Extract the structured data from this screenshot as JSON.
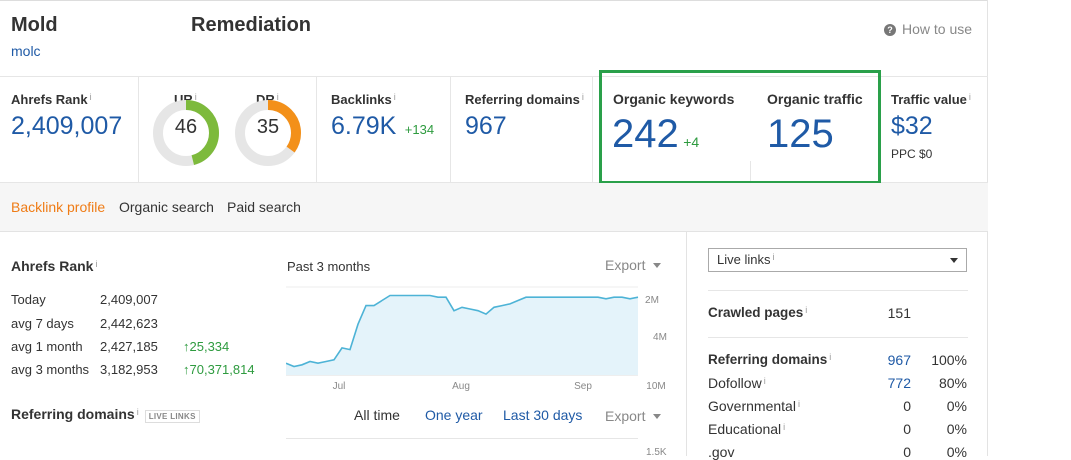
{
  "header": {
    "title": "Mold",
    "subtitle": "molc",
    "section_title": "Remediation",
    "how_to_use": "How to use"
  },
  "metrics": {
    "ahrefs_rank": {
      "label": "Ahrefs Rank",
      "value": "2,409,007"
    },
    "ur": {
      "label": "UR",
      "value": "46",
      "score": 46,
      "color": "#7dba3c"
    },
    "dr": {
      "label": "DR",
      "value": "35",
      "score": 35,
      "color": "#f39019"
    },
    "backlinks": {
      "label": "Backlinks",
      "value": "6.79K",
      "delta": "+134"
    },
    "referring_domains": {
      "label": "Referring domains",
      "value": "967"
    },
    "organic_keywords": {
      "label": "Organic keywords",
      "value": "242",
      "delta": "+4"
    },
    "organic_traffic": {
      "label": "Organic traffic",
      "value": "125"
    },
    "traffic_value": {
      "label": "Traffic value",
      "value": "$32",
      "ppc": "PPC $0"
    },
    "highlight_color": "#2aa04a"
  },
  "tabs": [
    {
      "label": "Backlink profile",
      "active": true
    },
    {
      "label": "Organic search",
      "active": false
    },
    {
      "label": "Paid search",
      "active": false
    }
  ],
  "rank_panel": {
    "title": "Ahrefs Rank",
    "rows": [
      {
        "label": "Today",
        "value": "2,409,007",
        "delta": ""
      },
      {
        "label": "avg 7 days",
        "value": "2,442,623",
        "delta": ""
      },
      {
        "label": "avg 1 month",
        "value": "2,427,185",
        "delta": "↑25,334"
      },
      {
        "label": "avg 3 months",
        "value": "3,182,953",
        "delta": "↑70,371,814"
      }
    ],
    "chart_label": "Past 3 months",
    "export": "Export"
  },
  "chart_data": {
    "type": "area",
    "title": "Past 3 months",
    "x_ticks": [
      "Jul",
      "Aug",
      "Sep"
    ],
    "y_ticks": [
      "2M",
      "4M",
      "10M"
    ],
    "y_reversed": true,
    "color": "#4db3d6",
    "series": [
      {
        "values": [
          6.3,
          6.5,
          6.4,
          6.2,
          6.3,
          6.2,
          6.1,
          5.4,
          5.5,
          4.0,
          2.9,
          2.9,
          2.6,
          2.3,
          2.3,
          2.3,
          2.3,
          2.3,
          2.3,
          2.4,
          2.4,
          3.2,
          3.0,
          3.1,
          3.2,
          3.4,
          3.0,
          2.9,
          2.8,
          2.6,
          2.4,
          2.4,
          2.4,
          2.4,
          2.4,
          2.4,
          2.4,
          2.4,
          2.4,
          2.4,
          2.5,
          2.4,
          2.4,
          2.5,
          2.4
        ]
      }
    ]
  },
  "ref_domains_panel": {
    "title": "Referring domains",
    "badge": "LIVE LINKS",
    "filters": [
      "All time",
      "One year",
      "Last 30 days"
    ],
    "export": "Export",
    "axis_top": "1.5K"
  },
  "side_panel": {
    "select_value": "Live links",
    "crawled_pages": {
      "label": "Crawled pages",
      "value": "151"
    },
    "rows": [
      {
        "label": "Referring domains",
        "value": "967",
        "pct": "100%",
        "bold": true,
        "link": true
      },
      {
        "label": "Dofollow",
        "value": "772",
        "pct": "80%",
        "bold": false,
        "link": true
      },
      {
        "label": "Governmental",
        "value": "0",
        "pct": "0%",
        "bold": false,
        "link": false
      },
      {
        "label": "Educational",
        "value": "0",
        "pct": "0%",
        "bold": false,
        "link": false
      },
      {
        "label": ".gov",
        "value": "0",
        "pct": "0%",
        "bold": false,
        "link": false
      }
    ]
  }
}
